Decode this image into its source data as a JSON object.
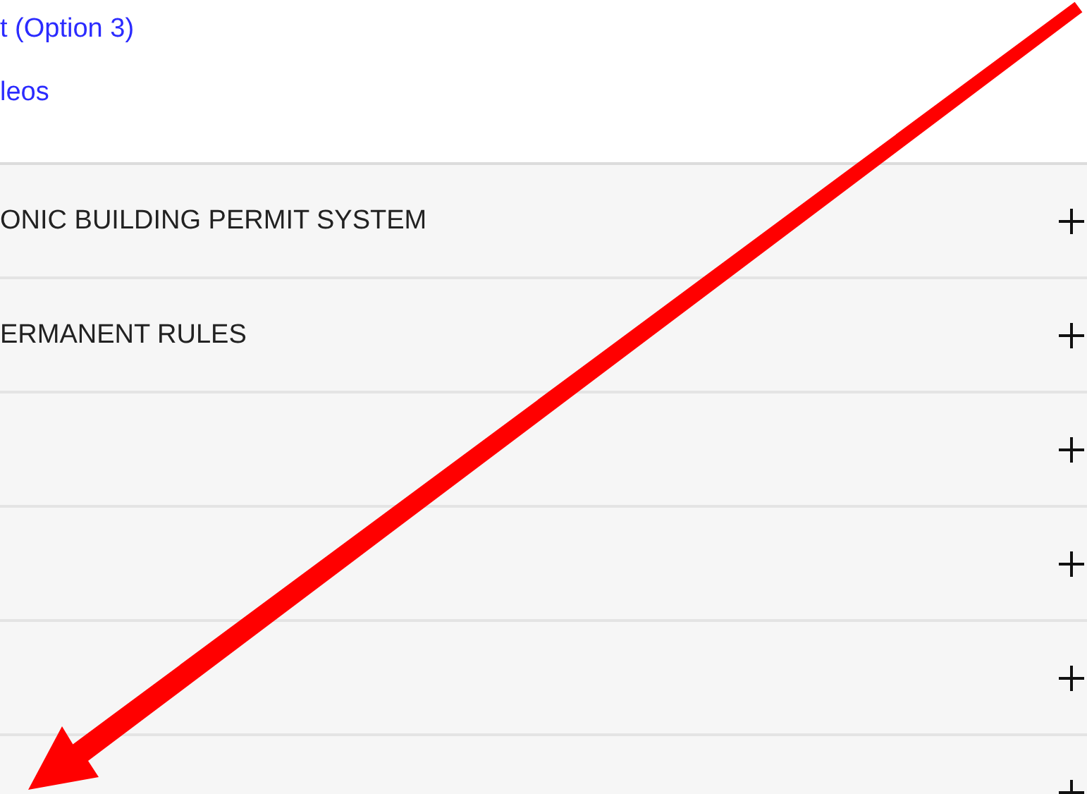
{
  "links": [
    "t (Option 3)",
    "leos"
  ],
  "accordion": [
    {
      "title": "ONIC BUILDING PERMIT SYSTEM",
      "expanded": false
    },
    {
      "title": "ERMANENT RULES",
      "expanded": false
    },
    {
      "expanded": false
    },
    {
      "expanded": false
    },
    {
      "expanded": false
    },
    {
      "expanded": false
    }
  ]
}
